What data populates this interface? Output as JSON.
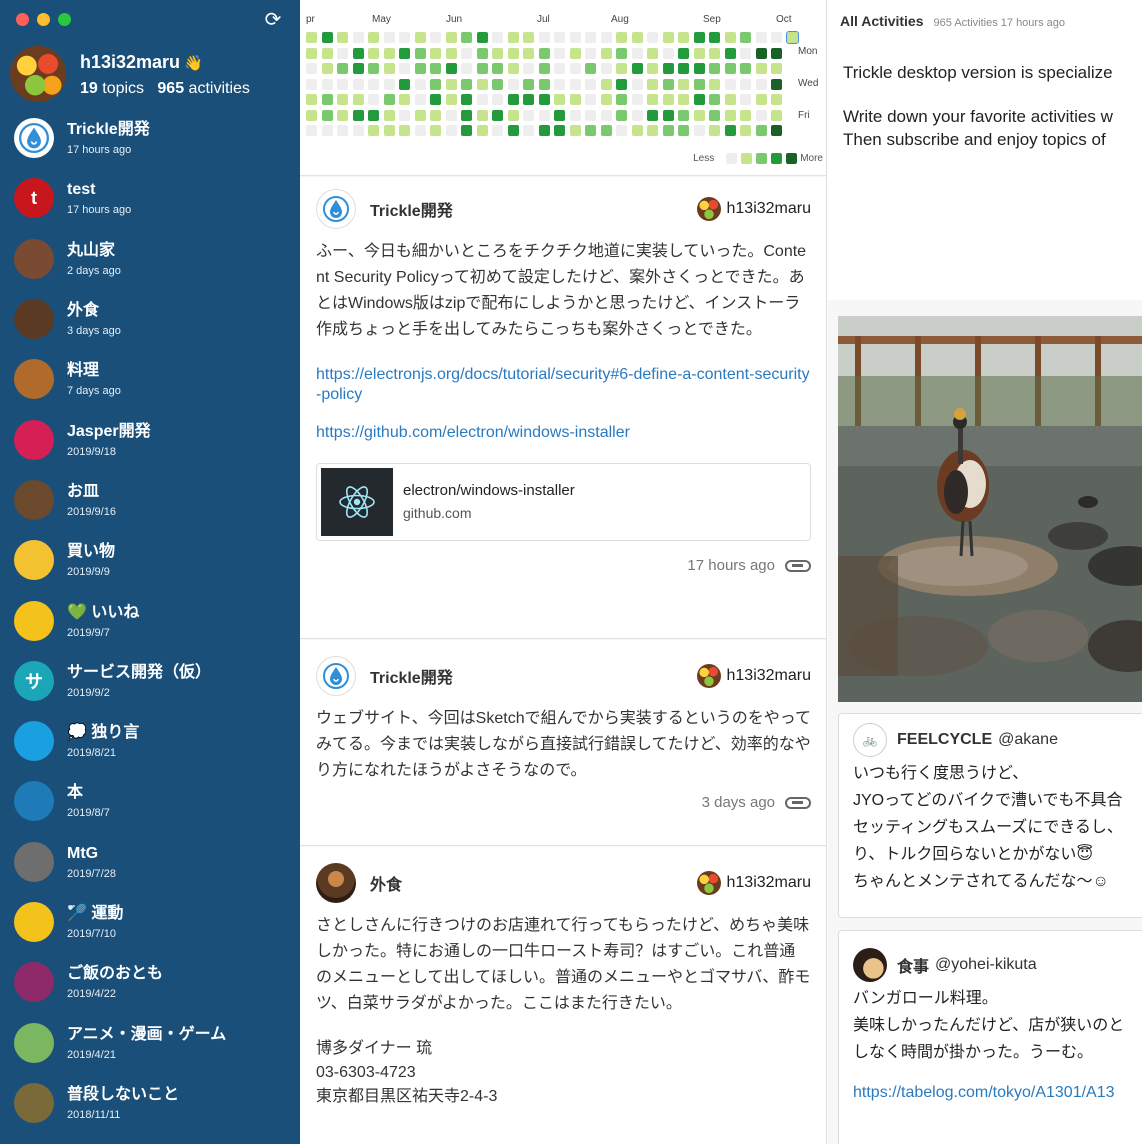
{
  "window": {
    "controls": [
      "close",
      "minimize",
      "zoom"
    ],
    "refresh_icon": "refresh-icon"
  },
  "profile": {
    "name": "h13i32maru",
    "emoji": "👋",
    "topics_count": "19",
    "topics_label": "topics",
    "activities_count": "965",
    "activities_label": "activities"
  },
  "topics": [
    {
      "name": "Trickle開発",
      "time": "17 hours ago",
      "icon": "trickle-drop-icon",
      "color": "#ffffff"
    },
    {
      "name": "test",
      "time": "17 hours ago",
      "icon": "letter-t-icon",
      "letter": "t",
      "color": "#c8161d"
    },
    {
      "name": "丸山家",
      "time": "2 days ago",
      "icon": "family-photo-icon",
      "color": "#7a4a32"
    },
    {
      "name": "外食",
      "time": "3 days ago",
      "icon": "restaurant-photo-icon",
      "color": "#5a3a22"
    },
    {
      "name": "料理",
      "time": "7 days ago",
      "icon": "cooking-photo-icon",
      "color": "#b06a2c"
    },
    {
      "name": "Jasper開発",
      "time": "2019/9/18",
      "icon": "jasper-icon",
      "color": "#d61f55"
    },
    {
      "name": "お皿",
      "time": "2019/9/16",
      "icon": "plate-photo-icon",
      "color": "#6b4a2e"
    },
    {
      "name": "買い物",
      "time": "2019/9/9",
      "icon": "shopping-icon",
      "color": "#f2c230"
    },
    {
      "name": "💚 いいね",
      "time": "2019/9/7",
      "icon": "green-heart-icon",
      "color": "#f3c21b"
    },
    {
      "name": "サービス開発（仮）",
      "time": "2019/9/2",
      "icon": "letter-sa-icon",
      "letter": "サ",
      "color": "#1aa6b7"
    },
    {
      "name": "💭 独り言",
      "time": "2019/8/21",
      "icon": "thought-bubble-icon",
      "color": "#1aa0e0"
    },
    {
      "name": "本",
      "time": "2019/8/7",
      "icon": "kindle-icon",
      "color": "#1f7ab8"
    },
    {
      "name": "MtG",
      "time": "2019/7/28",
      "icon": "mtg-photo-icon",
      "color": "#6e6e6e"
    },
    {
      "name": "🏸 運動",
      "time": "2019/7/10",
      "icon": "badminton-icon",
      "color": "#f3c21b"
    },
    {
      "name": "ご飯のおとも",
      "time": "2019/4/22",
      "icon": "yukari-icon",
      "color": "#8e2a6a"
    },
    {
      "name": "アニメ・漫画・ゲーム",
      "time": "2019/4/21",
      "icon": "anime-photo-icon",
      "color": "#7bb661"
    },
    {
      "name": "普段しないこと",
      "time": "2018/11/11",
      "icon": "temple-photo-icon",
      "color": "#7a6a3a"
    }
  ],
  "heatmap": {
    "months": [
      "pr",
      "May",
      "Jun",
      "Jul",
      "Aug",
      "Sep",
      "Oct"
    ],
    "days": [
      "Mon",
      "Wed",
      "Fri"
    ],
    "legend_less": "Less",
    "legend_more": "More",
    "colors": [
      "#eeeeee",
      "#c6e48b",
      "#7bc96f",
      "#239a3b",
      "#196127"
    ]
  },
  "posts": [
    {
      "topic": "Trickle開発",
      "user": "h13i32maru",
      "body": "ふー、今日も細かいところをチクチク地道に実装していった。Content Security Policyって初めて設定したけど、案外さくっとできた。あとはWindows版はzipで配布にしようかと思ったけど、インストーラ作成ちょっと手を出してみたらこっちも案外さくっとできた。",
      "links": [
        "https://electronjs.org/docs/tutorial/security#6-define-a-content-security-policy",
        "https://github.com/electron/windows-installer"
      ],
      "card_title": "electron/windows-installer",
      "card_domain": "github.com",
      "time": "17 hours ago"
    },
    {
      "topic": "Trickle開発",
      "user": "h13i32maru",
      "body": "ウェブサイト、今回はSketchで組んでから実装するというのをやってみてる。今までは実装しながら直接試行錯誤してたけど、効率的なやり方になれたほうがよさそうなので。",
      "time": "3 days ago"
    },
    {
      "topic": "外食",
      "user": "h13i32maru",
      "body": "さとしさんに行きつけのお店連れて行ってもらったけど、めちゃ美味しかった。特にお通しの一口牛ロースト寿司？はすごい。これ普通のメニューとして出してほしい。普通のメニューやとゴマサバ、酢モツ、白菜サラダがよかった。ここはまた行きたい。",
      "extra": [
        "博多ダイナー 琉",
        "03-6303-4723",
        "東京都目黒区祐天寺2-4-3"
      ]
    }
  ],
  "right": {
    "title": "All Activities",
    "subtitle": "965 Activities 17 hours ago",
    "line1": "Trickle desktop version is specialize",
    "line2": "Write down your favorite activities w",
    "line3": "Then subscribe and enjoy topics of",
    "feed": [
      {
        "topic": "FEELCYCLE",
        "user": "@akane",
        "lines": [
          "いつも行く度思うけど、",
          "JYOってどのバイクで漕いでも不具合",
          "セッティングもスムーズにできるし、",
          "り、トルク回らないとかがない😇",
          "ちゃんとメンテされてるんだな〜☺"
        ]
      },
      {
        "topic": "食事",
        "user": "@yohei-kikuta",
        "lines": [
          "バンガロール料理。",
          "美味しかったんだけど、店が狭いのと",
          "しなく時間が掛かった。うーむ。"
        ],
        "link": "https://tabelog.com/tokyo/A1301/A13"
      }
    ]
  }
}
